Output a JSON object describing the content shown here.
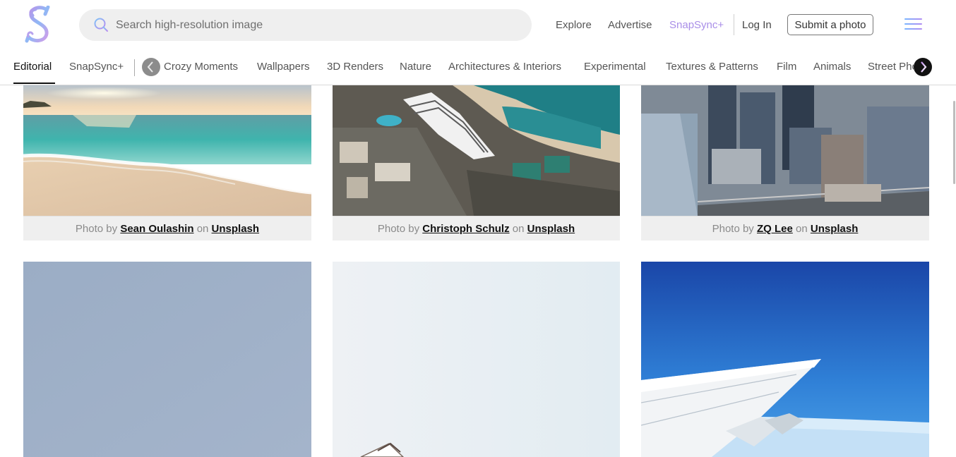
{
  "header": {
    "search_placeholder": "Search high-resolution image",
    "nav": {
      "explore": "Explore",
      "advertise": "Advertise",
      "snapsync": "SnapSync+",
      "login": "Log In",
      "submit": "Submit a photo"
    }
  },
  "categories": {
    "editorial": "Editorial",
    "snapsync": "SnapSync+",
    "items": [
      "Crozy Moments",
      "Wallpapers",
      "3D Renders",
      "Nature",
      "Architectures & Interiors",
      "Experimental",
      "Textures & Patterns",
      "Film",
      "Animals",
      "Street Photography"
    ]
  },
  "photos": [
    {
      "prefix": "Photo by",
      "author": "Sean Oulashin",
      "on": "on",
      "source": "Unsplash"
    },
    {
      "prefix": "Photo by",
      "author": "Christoph Schulz",
      "on": "on",
      "source": "Unsplash"
    },
    {
      "prefix": "Photo by",
      "author": "ZQ Lee",
      "on": "on",
      "source": "Unsplash"
    }
  ],
  "colors": {
    "accent": "#a98ee8",
    "credit_bg": "#efefef",
    "search_bg": "#efefef"
  },
  "icons": [
    "logo-s-icon",
    "search-icon",
    "menu-icon",
    "chevron-left-icon",
    "chevron-right-icon"
  ]
}
